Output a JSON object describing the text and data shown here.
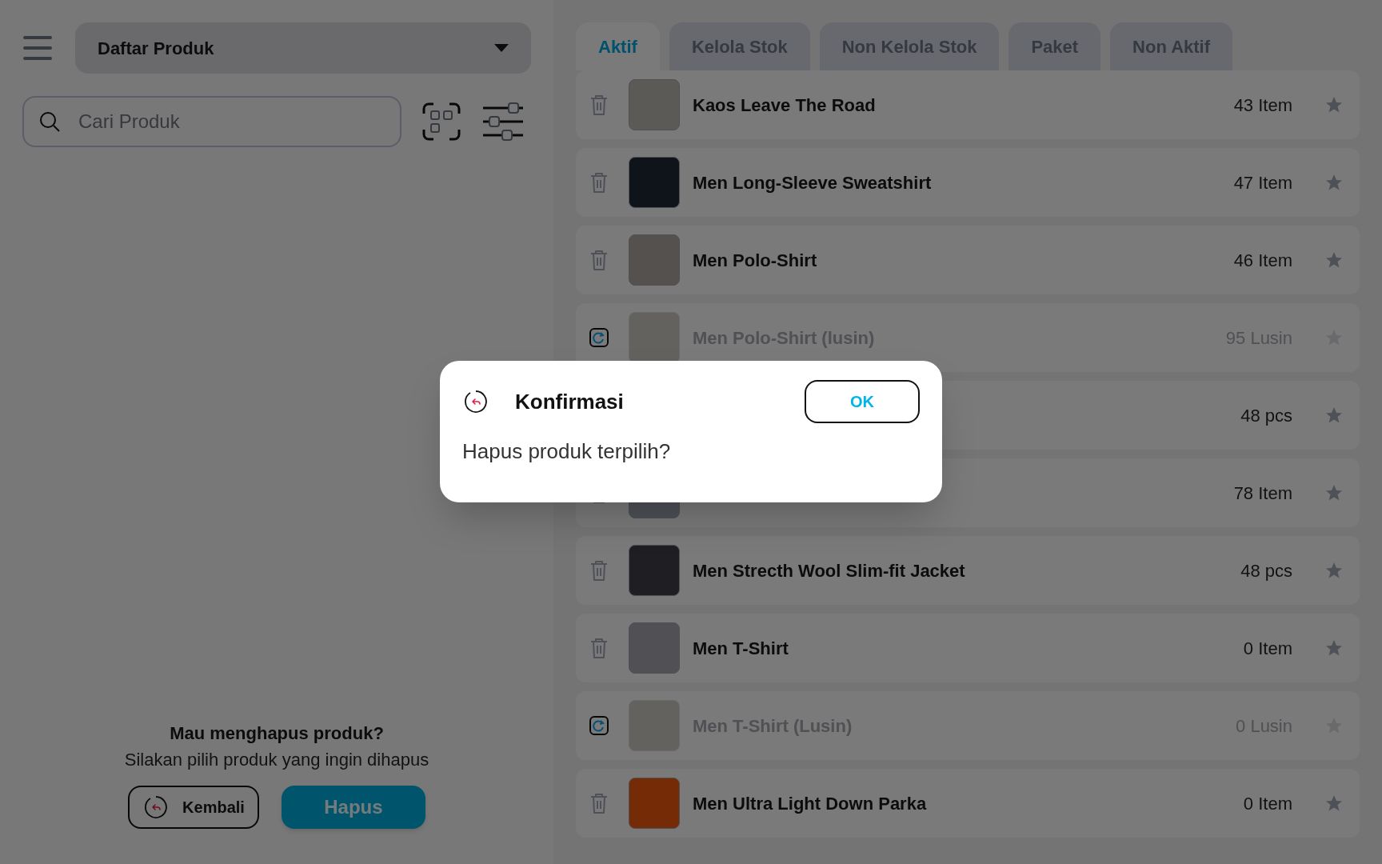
{
  "header": {
    "title": "Daftar Produk"
  },
  "search": {
    "placeholder": "Cari Produk"
  },
  "tabs": [
    {
      "label": "Aktif",
      "selected": true
    },
    {
      "label": "Kelola Stok",
      "selected": false
    },
    {
      "label": "Non Kelola Stok",
      "selected": false
    },
    {
      "label": "Paket",
      "selected": false
    },
    {
      "label": "Non Aktif",
      "selected": false
    }
  ],
  "products": [
    {
      "kind": "active",
      "name": "Kaos Leave The Road",
      "quantity": "43 Item"
    },
    {
      "kind": "active",
      "name": "Men Long-Sleeve Sweatshirt",
      "quantity": "47 Item"
    },
    {
      "kind": "active",
      "name": "Men Polo-Shirt",
      "quantity": "46 Item"
    },
    {
      "kind": "inactive",
      "name": "Men Polo-Shirt (lusin)",
      "quantity": "95 Lusin"
    },
    {
      "kind": "active",
      "quantity": "48 pcs"
    },
    {
      "kind": "active",
      "quantity": "78 Item"
    },
    {
      "kind": "active",
      "name": "Men Strecth Wool Slim-fit Jacket",
      "quantity": "48 pcs"
    },
    {
      "kind": "active",
      "name": "Men T-Shirt",
      "quantity": "0 Item"
    },
    {
      "kind": "inactive",
      "name": "Men T-Shirt (Lusin)",
      "quantity": "0 Lusin"
    },
    {
      "kind": "active",
      "name": "Men Ultra Light Down Parka",
      "quantity": "0 Item"
    }
  ],
  "delete_prompt": {
    "title": "Mau menghapus produk?",
    "message": "Silakan pilih produk yang ingin dihapus",
    "back_button": "Kembali",
    "delete_button": "Hapus"
  },
  "dialog": {
    "title": "Konfirmasi",
    "message": "Hapus produk terpilih?",
    "ok_button": "OK"
  }
}
